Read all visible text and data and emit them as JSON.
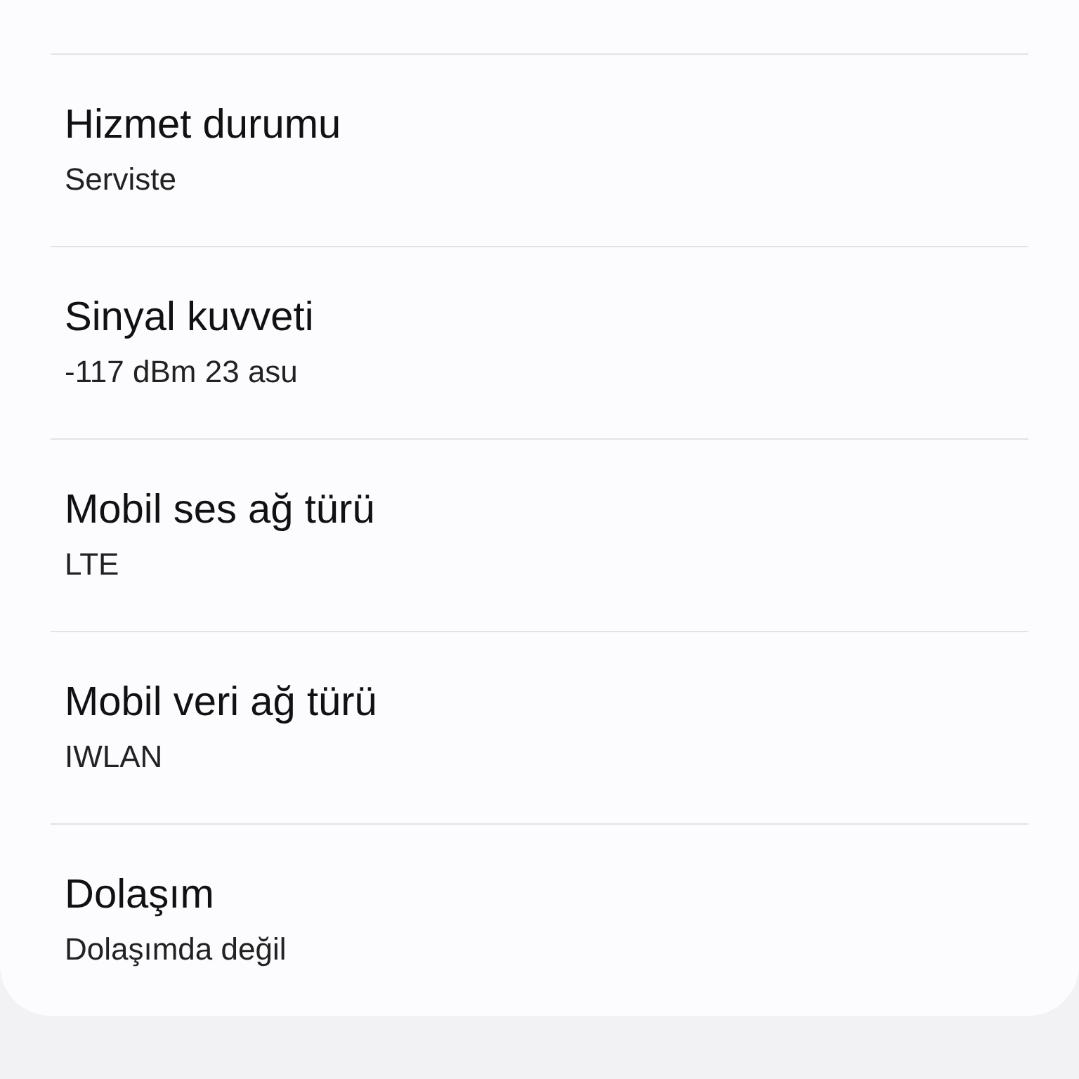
{
  "items": [
    {
      "title": "Hizmet durumu",
      "value": "Serviste"
    },
    {
      "title": "Sinyal kuvveti",
      "value": "-117 dBm 23 asu"
    },
    {
      "title": "Mobil ses ağ türü",
      "value": "LTE"
    },
    {
      "title": "Mobil veri ağ türü",
      "value": "IWLAN"
    },
    {
      "title": "Dolaşım",
      "value": "Dolaşımda değil"
    }
  ]
}
